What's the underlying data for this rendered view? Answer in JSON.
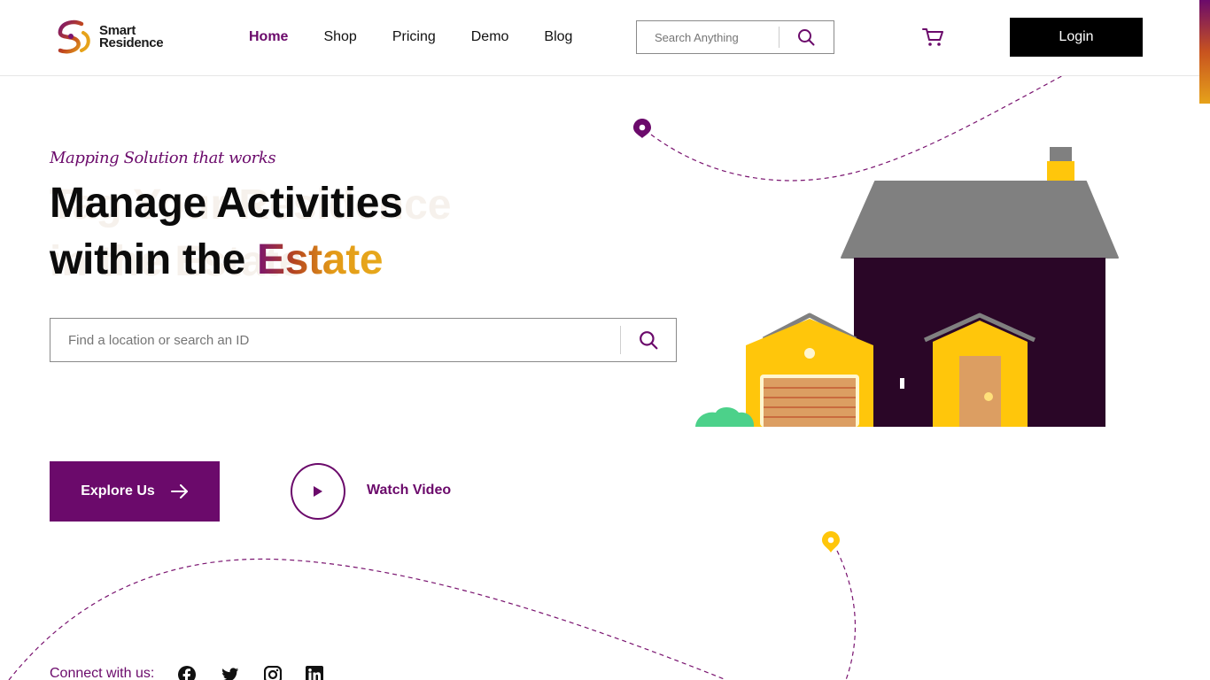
{
  "brand": {
    "line1": "Smart",
    "line2": "Residence"
  },
  "nav": {
    "items": [
      {
        "label": "Home",
        "active": true
      },
      {
        "label": "Shop",
        "active": false
      },
      {
        "label": "Pricing",
        "active": false
      },
      {
        "label": "Demo",
        "active": false
      },
      {
        "label": "Blog",
        "active": false
      }
    ]
  },
  "header_search": {
    "placeholder": "Search Anything",
    "icon": "search-icon"
  },
  "cart": {
    "icon": "cart-icon"
  },
  "login": {
    "label": "Login"
  },
  "hero": {
    "tagline": "Mapping Solution that works",
    "ghost_line1": "Tag Your Residence",
    "ghost_line2": "in the Estate",
    "title_line1": "Manage Activities",
    "title_line2_prefix": "within the ",
    "title_highlight": "Estate",
    "search_placeholder": "Find a location or search an ID"
  },
  "cta": {
    "explore_label": "Explore Us",
    "watch_label": "Watch Video"
  },
  "connect": {
    "label": "Connect with us:",
    "icons": [
      "facebook-icon",
      "twitter-icon",
      "instagram-icon",
      "linkedin-icon"
    ]
  },
  "colors": {
    "brand_purple": "#6b0a6b",
    "gold": "#ffc60b",
    "house_dark": "#2a0627",
    "roof_grey": "#808080",
    "door_tan": "#dc9e62",
    "bush_green": "#4cd18a"
  }
}
